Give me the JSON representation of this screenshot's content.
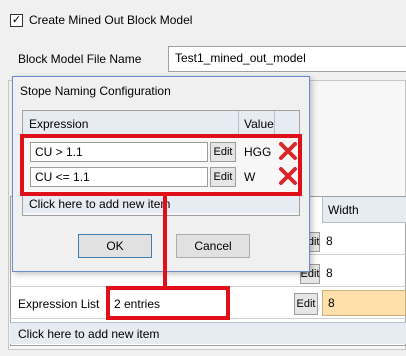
{
  "main": {
    "checkbox_label": "Create Mined Out Block Model",
    "checkbox_mark": "✓",
    "file_name_label": "Block Model File Name",
    "file_name_value": "Test1_mined_out_model",
    "grid_header": "Width",
    "rows": [
      {
        "edit": "Edit",
        "width": "8"
      },
      {
        "edit": "Edit",
        "width": "8"
      }
    ],
    "expression_list_label": "Expression List",
    "expression_list_value": "2 entries",
    "expression_edit": "Edit",
    "expression_width": "8",
    "add_item": "Click here to add new item"
  },
  "dialog": {
    "title": "Stope Naming Configuration",
    "headers": {
      "expression": "Expression",
      "value": "Value"
    },
    "rows": [
      {
        "expression": "CU > 1.1",
        "edit": "Edit",
        "value": "HGG"
      },
      {
        "expression": "CU <= 1.1",
        "edit": "Edit",
        "value": "W"
      }
    ],
    "add_item": "Click here to add new item",
    "ok": "OK",
    "cancel": "Cancel"
  },
  "colors": {
    "annotation_red": "#e0101a",
    "highlight_orange": "#ffe0aa",
    "delete_red": "#d9262a"
  }
}
